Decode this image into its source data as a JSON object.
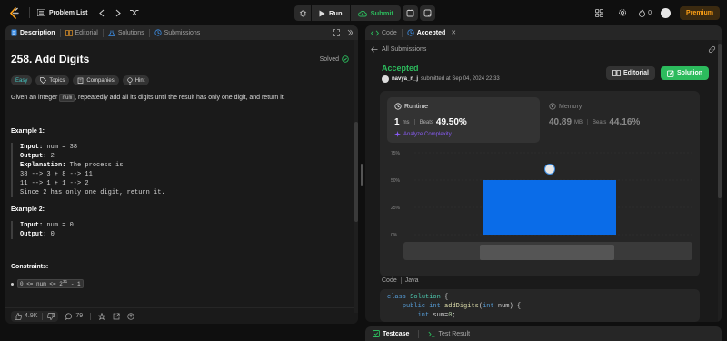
{
  "nav": {
    "problem_list": "Problem List",
    "run": "Run",
    "submit": "Submit",
    "streak": "0",
    "premium": "Premium"
  },
  "left": {
    "tabs": [
      "Description",
      "Editorial",
      "Solutions",
      "Submissions"
    ],
    "title": "258. Add Digits",
    "solved": "Solved",
    "tags": [
      "Easy",
      "Topics",
      "Companies",
      "Hint"
    ],
    "desc_pre": "Given an integer ",
    "desc_code": "num",
    "desc_post": ", repeatedly add all its digits until the result has only one digit, and return it.",
    "ex1_title": "Example 1:",
    "ex1": {
      "input_label": "Input:",
      "input": "num = 38",
      "output_label": "Output:",
      "output": "2",
      "expl_label": "Explanation:",
      "expl": "The process is",
      "line1": "38 --> 3 + 8 --> 11",
      "line2": "11 --> 1 + 1 --> 2",
      "line3": "Since 2 has only one digit, return it."
    },
    "ex2_title": "Example 2:",
    "ex2": {
      "input_label": "Input:",
      "input": "num = 0",
      "output_label": "Output:",
      "output": "0"
    },
    "constraints_title": "Constraints:",
    "constraint_pre": "0 <= num <= 2",
    "constraint_sup": "31",
    "constraint_post": " - 1",
    "likes": "4.9K",
    "comments": "79"
  },
  "right": {
    "tabs": [
      "Code",
      "Accepted"
    ],
    "back": "All Submissions",
    "status": "Accepted",
    "user": "navya_n_j",
    "submitted": "submitted at Sep 04, 2024 22:33",
    "editorial_btn": "Editorial",
    "solution_btn": "Solution",
    "runtime_label": "Runtime",
    "runtime_value": "1",
    "runtime_unit": "ms",
    "beats_label": "Beats",
    "runtime_beats": "49.50%",
    "analyze": "Analyze Complexity",
    "memory_label": "Memory",
    "memory_value": "40.89",
    "memory_unit": "MB",
    "memory_beats": "44.16%",
    "code_label": "Code",
    "language": "Java",
    "code_lines": [
      "class Solution {",
      "    public int addDigits(int num) {",
      "        int sum=0;"
    ],
    "bottom_tabs": [
      "Testcase",
      "Test Result"
    ]
  },
  "chart_data": {
    "type": "bar",
    "ytick_labels": [
      "75%",
      "50%",
      "25%",
      "0%"
    ],
    "ylim": [
      0,
      75
    ],
    "values": [
      50
    ],
    "bar_color": "#0a6ce8",
    "highlighted": true
  },
  "colors": {
    "accent_green": "#2cbb5d",
    "accepted": "#2cbb5d",
    "premium": "#ffa116",
    "bar": "#0a6ce8"
  }
}
